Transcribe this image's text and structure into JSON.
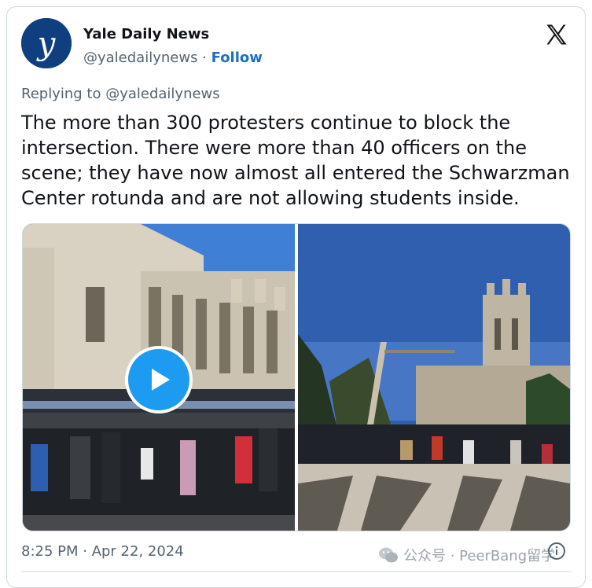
{
  "author": {
    "display_name": "Yale Daily News",
    "handle": "@yaledailynews",
    "separator": " · ",
    "follow_label": "Follow",
    "avatar_letter": "y"
  },
  "replying_to": "Replying to @yaledailynews",
  "tweet_text": "The more than 300 protesters continue to block the intersection. There were more than 40 officers on the scene; they have now almost all entered the Schwarzman Center rotunda and are not allowing students inside.",
  "timestamp": "8:25 PM · Apr 22, 2024",
  "watermark": "公众号 · PeerBang留学",
  "colors": {
    "brand_blue": "#1d9bf0",
    "follow_blue": "#1d6fc6",
    "avatar_navy": "#0f3f7f",
    "text_primary": "#0f1419",
    "text_secondary": "#536471"
  },
  "icons": {
    "platform": "x-logo-icon",
    "play": "play-icon",
    "info": "info-icon",
    "watermark": "wechat-icon"
  }
}
